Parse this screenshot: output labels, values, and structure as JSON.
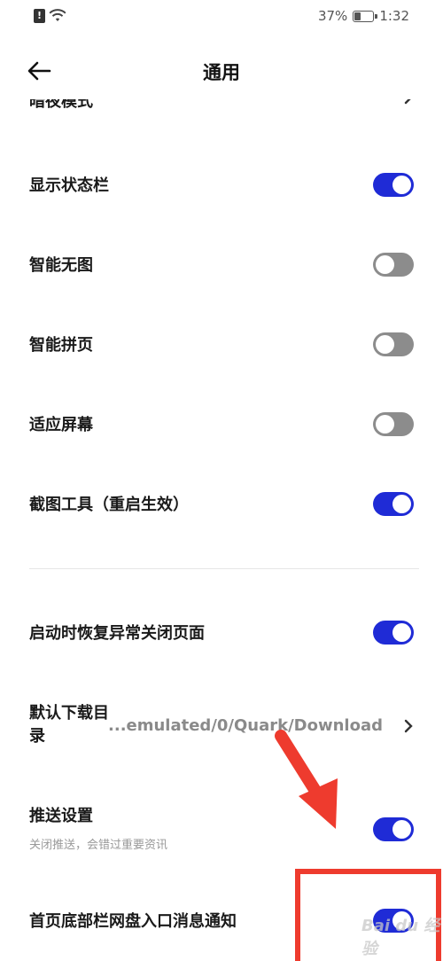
{
  "status_bar": {
    "alert_icon": "!",
    "battery_text": "37%",
    "battery_level": 0.37,
    "time": "1:32"
  },
  "header": {
    "title": "通用"
  },
  "settings": {
    "partial_top_label": "暗夜模式",
    "items": [
      {
        "label": "显示状态栏",
        "toggle": "on"
      },
      {
        "label": "智能无图",
        "toggle": "off"
      },
      {
        "label": "智能拼页",
        "toggle": "off"
      },
      {
        "label": "适应屏幕",
        "toggle": "off"
      },
      {
        "label": "截图工具（重启生效）",
        "toggle": "on"
      },
      {
        "label": "启动时恢复异常关闭页面",
        "toggle": "on"
      },
      {
        "label_line1": "默认下载目",
        "label_line2": "录",
        "value": "...emulated/0/Quark/Download"
      },
      {
        "label": "推送设置",
        "sublabel": "关闭推送，会错过重要资讯",
        "toggle": "on"
      },
      {
        "label": "首页底部栏网盘入口消息通知",
        "toggle": "on"
      }
    ]
  },
  "overlay": {
    "arrow_color": "#ee3b2e",
    "box_color": "#ee3b2e",
    "watermark": "Bai du 经验"
  },
  "colors": {
    "toggle_on": "#1f2bd6",
    "toggle_off": "#8c8c8c"
  }
}
